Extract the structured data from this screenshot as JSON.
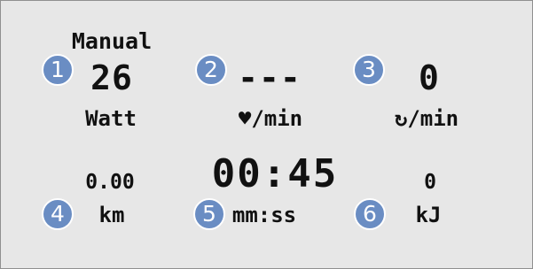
{
  "mode": "Manual",
  "metrics": [
    {
      "badge": "1",
      "value": "26",
      "unit": "Watt"
    },
    {
      "badge": "2",
      "value": "---",
      "unit": "♥/min"
    },
    {
      "badge": "3",
      "value": "0",
      "unit": "↻/min"
    },
    {
      "badge": "4",
      "value": "0.00",
      "unit": "km"
    },
    {
      "badge": "5",
      "value": "00:45",
      "unit": "mm:ss"
    },
    {
      "badge": "6",
      "value": "0",
      "unit": "kJ"
    }
  ],
  "colors": {
    "panel_background": "#e7e7e7",
    "badge": "#6a8dc3",
    "text": "#111111"
  }
}
